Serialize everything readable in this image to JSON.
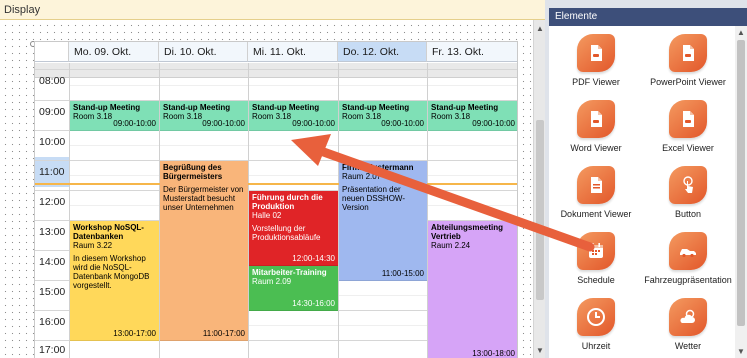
{
  "display": {
    "title": "Display"
  },
  "schedule": {
    "days": [
      {
        "label": "Mo. 09. Okt."
      },
      {
        "label": "Di. 10. Okt."
      },
      {
        "label": "Mi. 11. Okt."
      },
      {
        "label": "Do. 12. Okt."
      },
      {
        "label": "Fr. 13. Okt."
      }
    ],
    "hours": [
      "08:00",
      "09:00",
      "10:00",
      "11:00",
      "12:00",
      "13:00",
      "14:00",
      "15:00",
      "16:00",
      "17:00"
    ],
    "events": [
      {
        "title": "Stand-up Meeting",
        "room": "Room 3.18",
        "time": "09:00-10:00"
      },
      {
        "title": "Stand-up Meeting",
        "room": "Room 3.18",
        "time": "09:00-10:00"
      },
      {
        "title": "Stand-up Meeting",
        "room": "Room 3.18",
        "time": "09:00-10:00"
      },
      {
        "title": "Stand-up Meeting",
        "room": "Room 3.18",
        "time": "09:00-10:00"
      },
      {
        "title": "Stand-up Meeting",
        "room": "Room 3.18",
        "time": "09:00-10:00"
      },
      {
        "title": "Begrüßung des Bürgermeisters",
        "desc": "Der Bürgermeister von Musterstadt besucht unser Unternehmen",
        "time": "11:00-17:00"
      },
      {
        "title": "Führung durch die Produktion",
        "room": "Halle 02",
        "desc": "Vorstellung der Produktionsabläufe",
        "time": "12:00-14:30"
      },
      {
        "title": "Mitarbeiter-Training",
        "room": "Raum 2.09",
        "time": "14:30-16:00"
      },
      {
        "title": "Firma Mustermann",
        "room": "Raum 2.07",
        "desc": "Präsentation der neuen DSSHOW-Version",
        "time": "11:00-15:00"
      },
      {
        "title": "Workshop NoSQL-Datenbanken",
        "room": "Raum 3.22",
        "desc": "In diesem Workshop wird die NoSQL-Datenbank MongoDB vorgestellt.",
        "time": "13:00-17:00"
      },
      {
        "title": "Abteilungsmeeting Vertrieb",
        "room": "Raum 2.24",
        "time": "13:00-18:00"
      }
    ]
  },
  "elements_panel": {
    "title": "Elemente",
    "items": [
      {
        "label": "PDF Viewer",
        "icon": "pdf-document-icon"
      },
      {
        "label": "PowerPoint Viewer",
        "icon": "powerpoint-document-icon"
      },
      {
        "label": "Word Viewer",
        "icon": "word-document-icon"
      },
      {
        "label": "Excel Viewer",
        "icon": "excel-document-icon"
      },
      {
        "label": "Dokument Viewer",
        "icon": "document-icon"
      },
      {
        "label": "Button",
        "icon": "touch-hand-icon"
      },
      {
        "label": "Schedule",
        "icon": "calendar-icon"
      },
      {
        "label": "Fahrzeugpräsentation",
        "icon": "car-icon"
      },
      {
        "label": "Uhrzeit",
        "icon": "clock-icon"
      },
      {
        "label": "Wetter",
        "icon": "weather-icon"
      }
    ]
  },
  "colors": {
    "standup": "#7fe0b6",
    "buergermeister": "#f9b57a",
    "fuehrung": "#e02427",
    "training": "#4bbe52",
    "mustermann": "#9fb8ef",
    "workshop": "#ffd85a",
    "vertrieb": "#d6a4f7",
    "drag_arrow": "#e8603c",
    "tile": "#ee7440"
  }
}
